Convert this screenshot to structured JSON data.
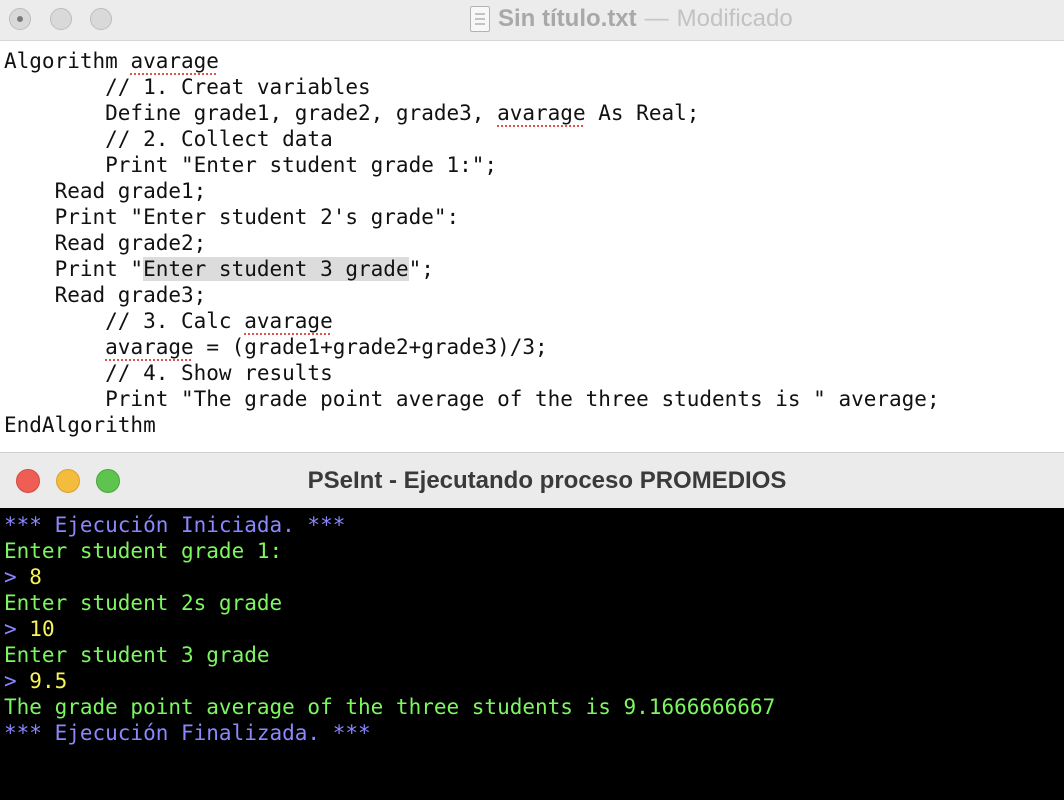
{
  "editor": {
    "title_main": "Sin título.txt",
    "title_dash": "—",
    "title_status": "Modificado",
    "lines": [
      [
        {
          "t": "Algorithm "
        },
        {
          "t": "avarage",
          "spell": true
        }
      ],
      [
        {
          "t": "        // 1. Creat variables"
        }
      ],
      [
        {
          "t": "        Define grade1, grade2, grade3, "
        },
        {
          "t": "avarage",
          "spell": true
        },
        {
          "t": " As Real;"
        }
      ],
      [
        {
          "t": "        // 2. Collect data"
        }
      ],
      [
        {
          "t": "        Print \"Enter student grade 1:\";"
        }
      ],
      [
        {
          "t": "    Read grade1;"
        }
      ],
      [
        {
          "t": "    Print \"Enter student 2's grade\":"
        }
      ],
      [
        {
          "t": "    Read grade2;"
        }
      ],
      [
        {
          "t": "    Print \""
        },
        {
          "t": "Enter student 3 grade",
          "sel": true
        },
        {
          "t": "\";"
        }
      ],
      [
        {
          "t": "    Read grade3;"
        }
      ],
      [
        {
          "t": "        // 3. Calc "
        },
        {
          "t": "avarage",
          "spell": true
        }
      ],
      [
        {
          "t": "        "
        },
        {
          "t": "avarage",
          "spell": true
        },
        {
          "t": " = (grade1+grade2+grade3)/3;"
        }
      ],
      [
        {
          "t": "        // 4. Show results"
        }
      ],
      [
        {
          "t": "        Print \"The grade point average of the three students is \" average;"
        }
      ],
      [
        {
          "t": "EndAlgorithm"
        }
      ]
    ]
  },
  "pseint": {
    "title": "PSeInt - Ejecutando proceso PROMEDIOS",
    "console": [
      {
        "parts": [
          {
            "t": "*** Ejecución Iniciada. ***",
            "c": "blue"
          }
        ]
      },
      {
        "parts": [
          {
            "t": "Enter student grade 1:",
            "c": "green"
          }
        ]
      },
      {
        "parts": [
          {
            "t": "> ",
            "c": "prompt"
          },
          {
            "t": "8",
            "c": "yellow"
          }
        ]
      },
      {
        "parts": [
          {
            "t": "Enter student 2s grade",
            "c": "green"
          }
        ]
      },
      {
        "parts": [
          {
            "t": "> ",
            "c": "prompt"
          },
          {
            "t": "10",
            "c": "yellow"
          }
        ]
      },
      {
        "parts": [
          {
            "t": "Enter student 3 grade",
            "c": "green"
          }
        ]
      },
      {
        "parts": [
          {
            "t": "> ",
            "c": "prompt"
          },
          {
            "t": "9.5",
            "c": "yellow"
          }
        ]
      },
      {
        "parts": [
          {
            "t": "The grade point average of the three students is 9.1666666667",
            "c": "green"
          }
        ]
      },
      {
        "parts": [
          {
            "t": "*** Ejecución Finalizada. ***",
            "c": "blue"
          }
        ]
      }
    ]
  },
  "colors": {
    "console_blue": "#8a87ff",
    "console_green": "#7cf760",
    "console_yellow": "#f6f35b",
    "spell_underline": "#e0524f",
    "selection": "#dcdcdc"
  }
}
